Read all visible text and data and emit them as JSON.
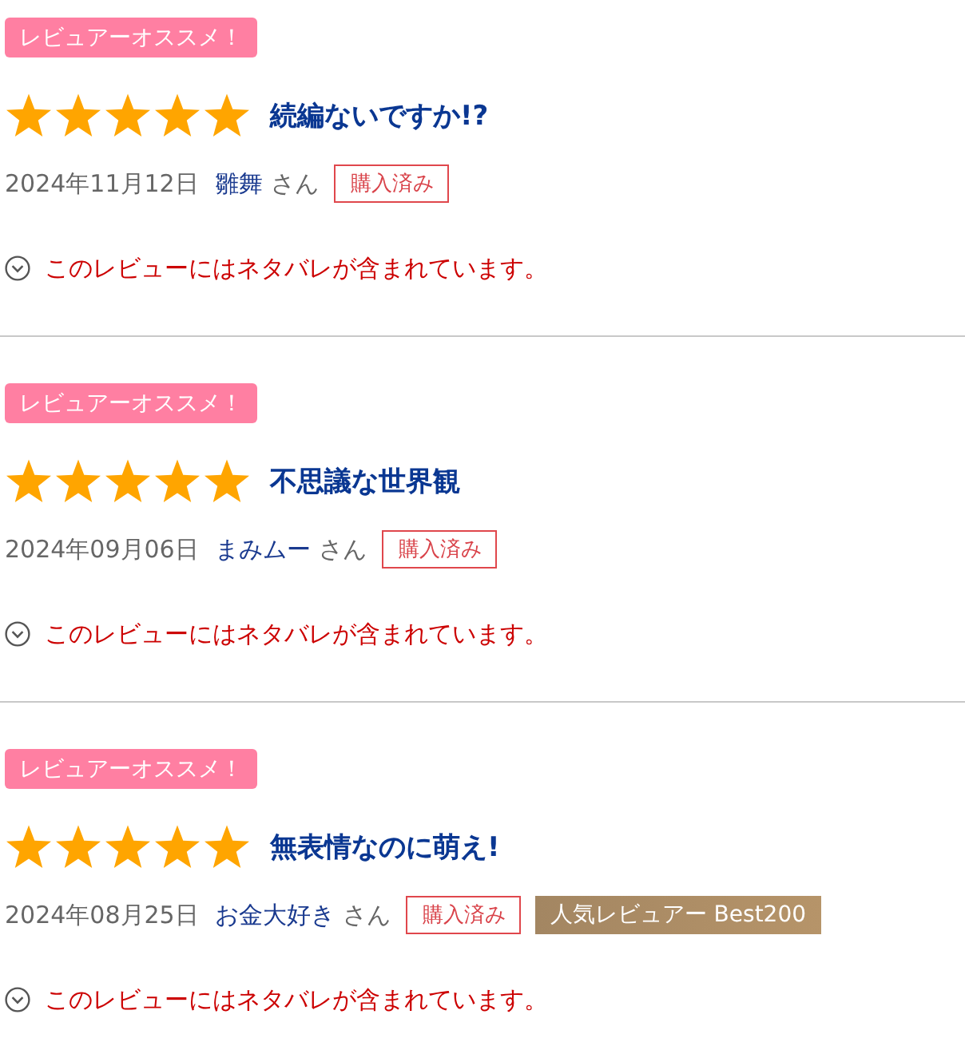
{
  "reviews": [
    {
      "recommend_badge": "レビュアーオススメ！",
      "stars": 5,
      "title": "続編ないですか!?",
      "date": "2024年11月12日",
      "reviewer": "雛舞",
      "honorific": "さん",
      "purchased_label": "購入済み",
      "spoiler_notice": "このレビューにはネタバレが含まれています。"
    },
    {
      "recommend_badge": "レビュアーオススメ！",
      "stars": 5,
      "title": "不思議な世界観",
      "date": "2024年09月06日",
      "reviewer": "まみムー",
      "honorific": "さん",
      "purchased_label": "購入済み",
      "spoiler_notice": "このレビューにはネタバレが含まれています。"
    },
    {
      "recommend_badge": "レビュアーオススメ！",
      "stars": 5,
      "title": "無表情なのに萌え!",
      "date": "2024年08月25日",
      "reviewer": "お金大好き",
      "honorific": "さん",
      "purchased_label": "購入済み",
      "ranking_badge": "人気レビュアー Best200",
      "spoiler_notice": "このレビューにはネタバレが含まれています。"
    }
  ]
}
